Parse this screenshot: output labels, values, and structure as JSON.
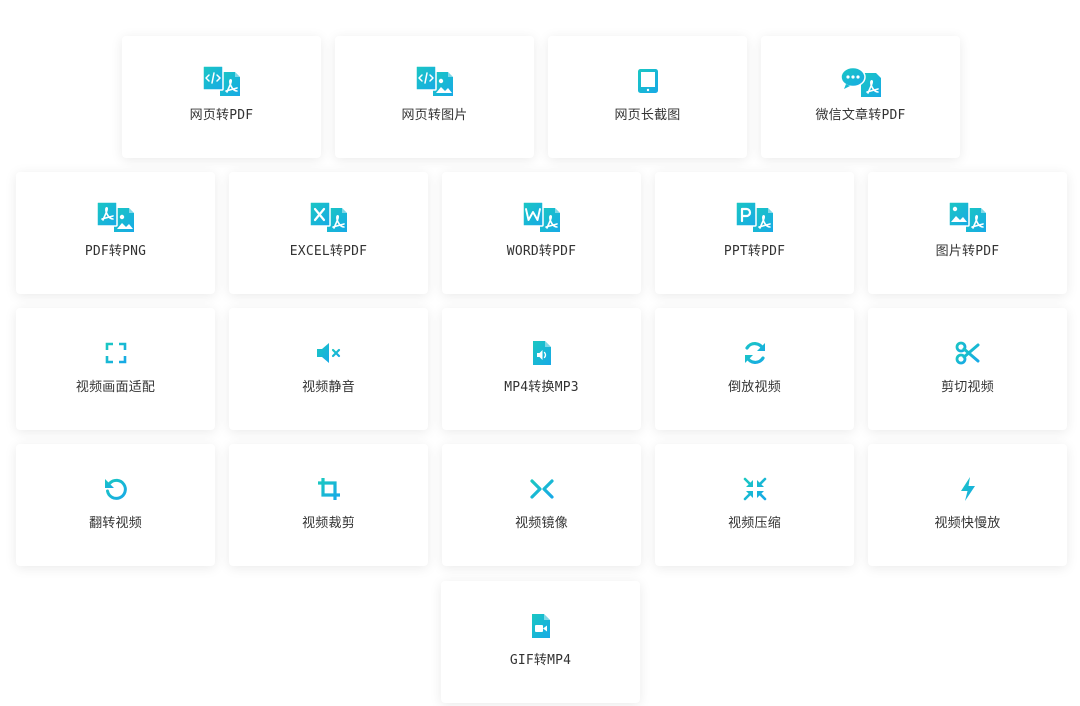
{
  "theme": {
    "gradient_start": "#1ac7c2",
    "gradient_end": "#17a9e6",
    "text_color": "#333333"
  },
  "rows": [
    [
      {
        "id": "web-to-pdf",
        "label": "网页转PDF",
        "icon": "code-pdf-icon"
      },
      {
        "id": "web-to-image",
        "label": "网页转图片",
        "icon": "code-image-icon"
      },
      {
        "id": "web-long-screenshot",
        "label": "网页长截图",
        "icon": "tablet-icon"
      },
      {
        "id": "wechat-article-to-pdf",
        "label": "微信文章转PDF",
        "icon": "chat-pdf-icon"
      }
    ],
    [
      {
        "id": "pdf-to-png",
        "label": "PDF转PNG",
        "icon": "pdf-image-icon"
      },
      {
        "id": "excel-to-pdf",
        "label": "EXCEL转PDF",
        "icon": "excel-pdf-icon"
      },
      {
        "id": "word-to-pdf",
        "label": "WORD转PDF",
        "icon": "word-pdf-icon"
      },
      {
        "id": "ppt-to-pdf",
        "label": "PPT转PDF",
        "icon": "ppt-pdf-icon"
      },
      {
        "id": "image-to-pdf",
        "label": "图片转PDF",
        "icon": "image-pdf-icon"
      }
    ],
    [
      {
        "id": "video-fit",
        "label": "视频画面适配",
        "icon": "fullscreen-icon"
      },
      {
        "id": "video-mute",
        "label": "视频静音",
        "icon": "volume-mute-icon"
      },
      {
        "id": "mp4-to-mp3",
        "label": "MP4转换MP3",
        "icon": "audio-file-icon"
      },
      {
        "id": "reverse-video",
        "label": "倒放视频",
        "icon": "refresh-icon"
      },
      {
        "id": "cut-video",
        "label": "剪切视频",
        "icon": "scissors-icon"
      }
    ],
    [
      {
        "id": "flip-video",
        "label": "翻转视频",
        "icon": "rotate-left-icon"
      },
      {
        "id": "crop-video",
        "label": "视频裁剪",
        "icon": "crop-icon"
      },
      {
        "id": "mirror-video",
        "label": "视频镜像",
        "icon": "mirror-icon"
      },
      {
        "id": "compress-video",
        "label": "视频压缩",
        "icon": "compress-icon"
      },
      {
        "id": "speed-video",
        "label": "视频快慢放",
        "icon": "lightning-icon"
      }
    ],
    [
      {
        "id": "gif-to-mp4",
        "label": "GIF转MP4",
        "icon": "video-file-icon"
      }
    ]
  ]
}
